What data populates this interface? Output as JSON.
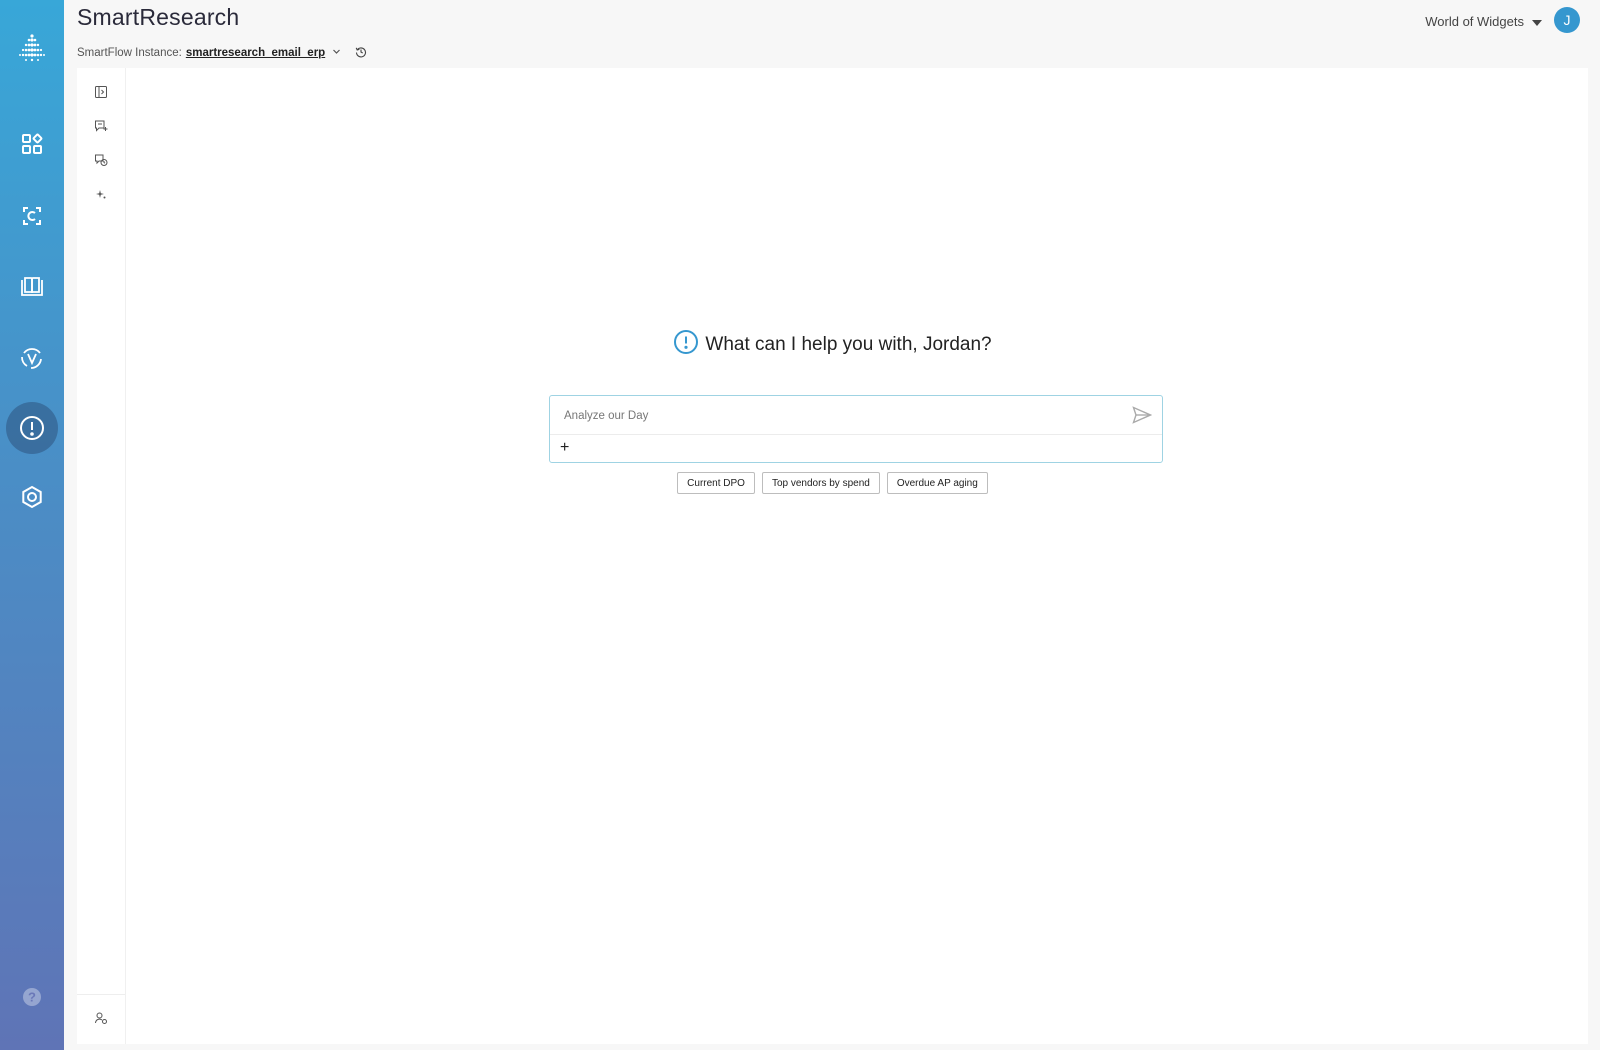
{
  "app": {
    "title": "SmartResearch"
  },
  "instance": {
    "label": "SmartFlow Instance:",
    "name": "smartresearch_email_erp"
  },
  "org": {
    "name": "World of Widgets"
  },
  "user": {
    "initial": "J"
  },
  "rail": {
    "items": [
      "logo-icon",
      "dashboard-icon",
      "c-document-icon",
      "book-icon",
      "v-cycle-icon",
      "alert-circle-icon",
      "gear-icon",
      "help-icon"
    ],
    "active": "alert-circle-icon",
    "colors": {
      "top": "#38a7d8",
      "bottom": "#5f74b6"
    }
  },
  "tools": {
    "items": [
      "sidebar-toggle-icon",
      "new-chat-icon",
      "chat-history-icon",
      "sparkle-icon",
      "user-settings-icon"
    ]
  },
  "chat": {
    "greeting": "What can I help you with, Jordan?",
    "placeholder": "Analyze our Day",
    "attach_label": "+"
  },
  "suggestions": [
    "Current DPO",
    "Top vendors by spend",
    "Overdue AP aging"
  ],
  "colors": {
    "accent": "#3597cf",
    "input_border": "#9fd3e3"
  }
}
